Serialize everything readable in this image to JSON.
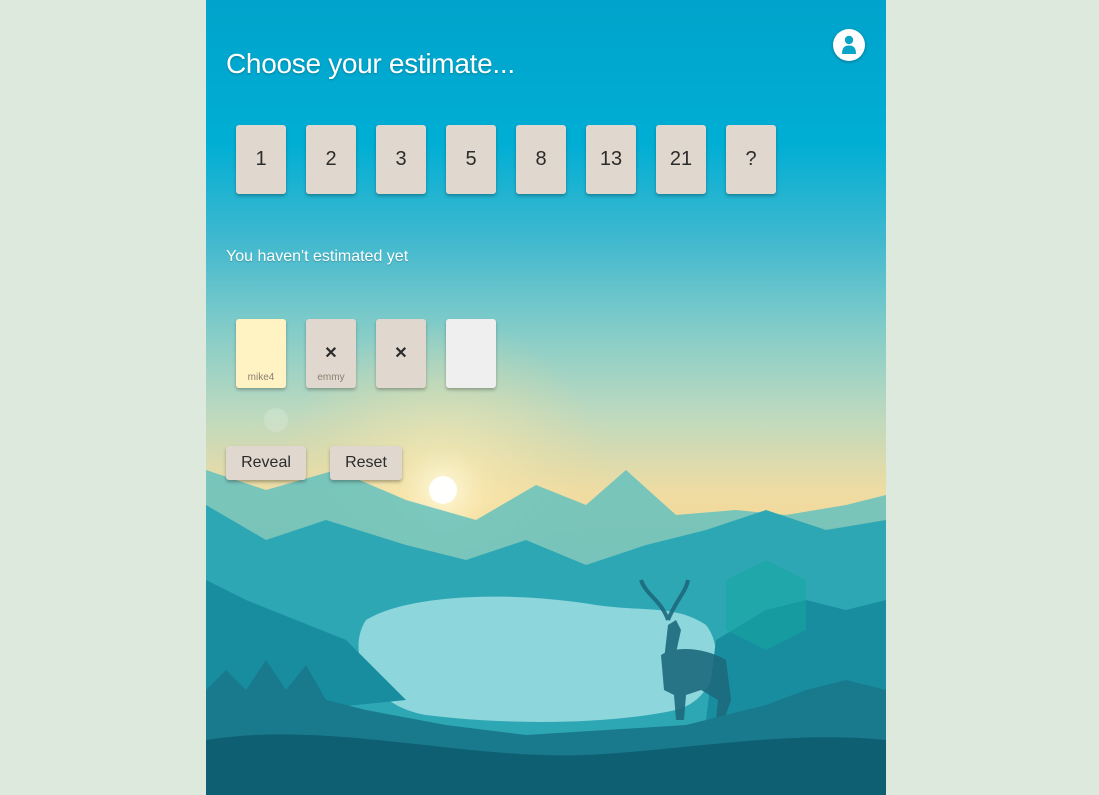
{
  "header": {
    "title": "Choose your estimate..."
  },
  "user_button": {
    "icon": "user-icon"
  },
  "estimate_cards": [
    {
      "label": "1"
    },
    {
      "label": "2"
    },
    {
      "label": "3"
    },
    {
      "label": "5"
    },
    {
      "label": "8"
    },
    {
      "label": "13"
    },
    {
      "label": "21"
    },
    {
      "label": "?"
    }
  ],
  "status_text": "You haven't estimated yet",
  "players": [
    {
      "name": "mike4",
      "mark": "",
      "state": "self"
    },
    {
      "name": "emmy",
      "mark": "✕",
      "state": "voted"
    },
    {
      "name": "",
      "mark": "✕",
      "state": "voted"
    },
    {
      "name": "",
      "mark": "",
      "state": "empty"
    }
  ],
  "actions": {
    "reveal_label": "Reveal",
    "reset_label": "Reset"
  },
  "colors": {
    "accent": "#00a3cb",
    "card": "#e0d8ce",
    "self_card": "#fff3c4",
    "page_background": "#dce9dc"
  }
}
